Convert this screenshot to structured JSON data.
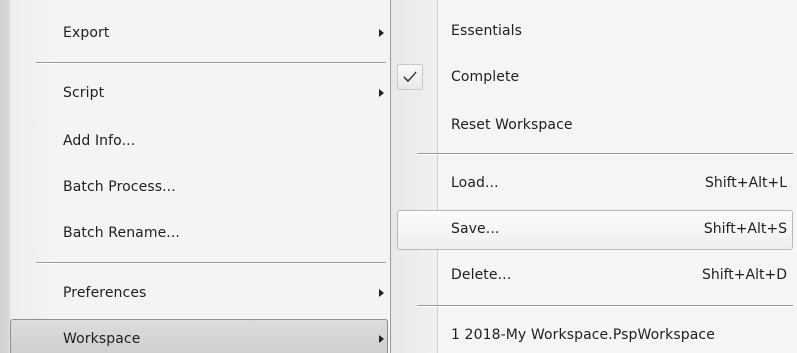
{
  "file_menu": {
    "items": [
      {
        "label": "Export",
        "has_submenu": true
      },
      {
        "label": "Script",
        "has_submenu": true
      },
      {
        "label": "Add Info...",
        "has_submenu": false
      },
      {
        "label": "Batch Process...",
        "has_submenu": false
      },
      {
        "label": "Batch Rename...",
        "has_submenu": false
      },
      {
        "label": "Preferences",
        "has_submenu": true
      },
      {
        "label": "Workspace",
        "has_submenu": true,
        "active": true
      }
    ]
  },
  "workspace_menu": {
    "items": [
      {
        "label": "Essentials"
      },
      {
        "label": "Complete",
        "checked": true,
        "icon": "checkmark-icon"
      },
      {
        "label": "Reset Workspace"
      },
      {
        "label": "Load...",
        "shortcut": "Shift+Alt+L"
      },
      {
        "label": "Save...",
        "shortcut": "Shift+Alt+S",
        "hovered": true
      },
      {
        "label": "Delete...",
        "shortcut": "Shift+Alt+D"
      },
      {
        "label": "1 2018-My Workspace.PspWorkspace"
      }
    ]
  },
  "colors": {
    "menu_bg": "#f4f4f4",
    "text": "#1e1e1e",
    "separator": "#9a9a9a",
    "active_highlight": "#d4d4d4",
    "hover_border": "#b9b9b9"
  }
}
